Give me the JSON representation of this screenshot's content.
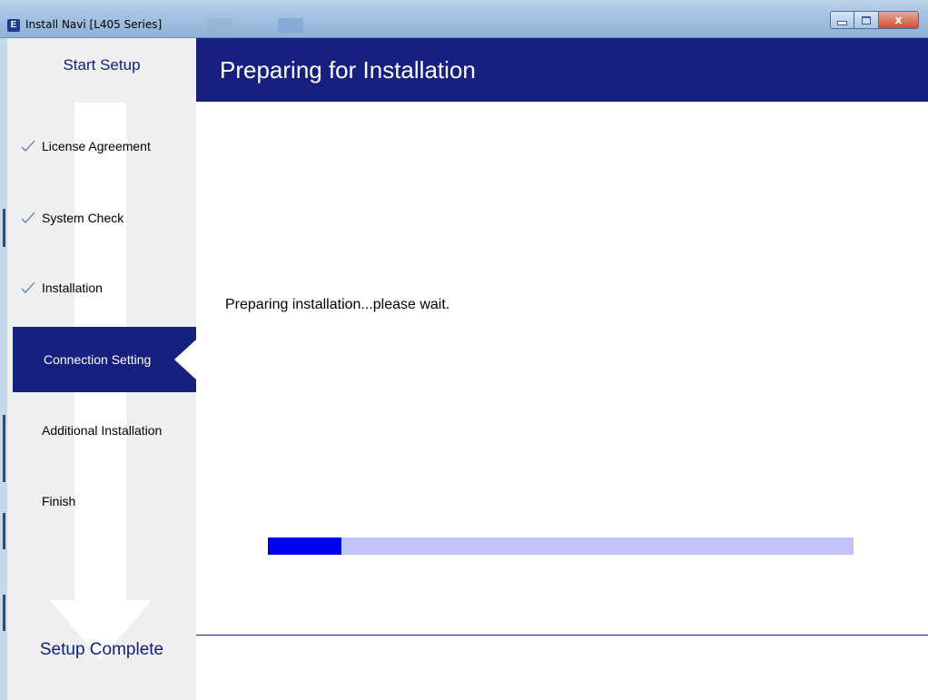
{
  "window": {
    "title": "Install Navi [L405 Series]",
    "app_icon_glyph": "E",
    "close_glyph": "x"
  },
  "sidebar": {
    "start_label": "Start Setup",
    "complete_label": "Setup Complete",
    "steps": [
      {
        "label": "License Agreement",
        "state": "done"
      },
      {
        "label": "System Check",
        "state": "done"
      },
      {
        "label": "Installation",
        "state": "done"
      },
      {
        "label": "Connection Setting",
        "state": "active"
      },
      {
        "label": "Additional Installation",
        "state": "pending"
      },
      {
        "label": "Finish",
        "state": "pending"
      }
    ]
  },
  "main": {
    "header_title": "Preparing for Installation",
    "message": "Preparing installation...please wait.",
    "progress_fraction": 0.126
  },
  "colors": {
    "brand_navy": "#17207e",
    "progress_fill": "#0000f2",
    "progress_track": "#c3c3f7",
    "check_color": "#5a7fb5"
  }
}
